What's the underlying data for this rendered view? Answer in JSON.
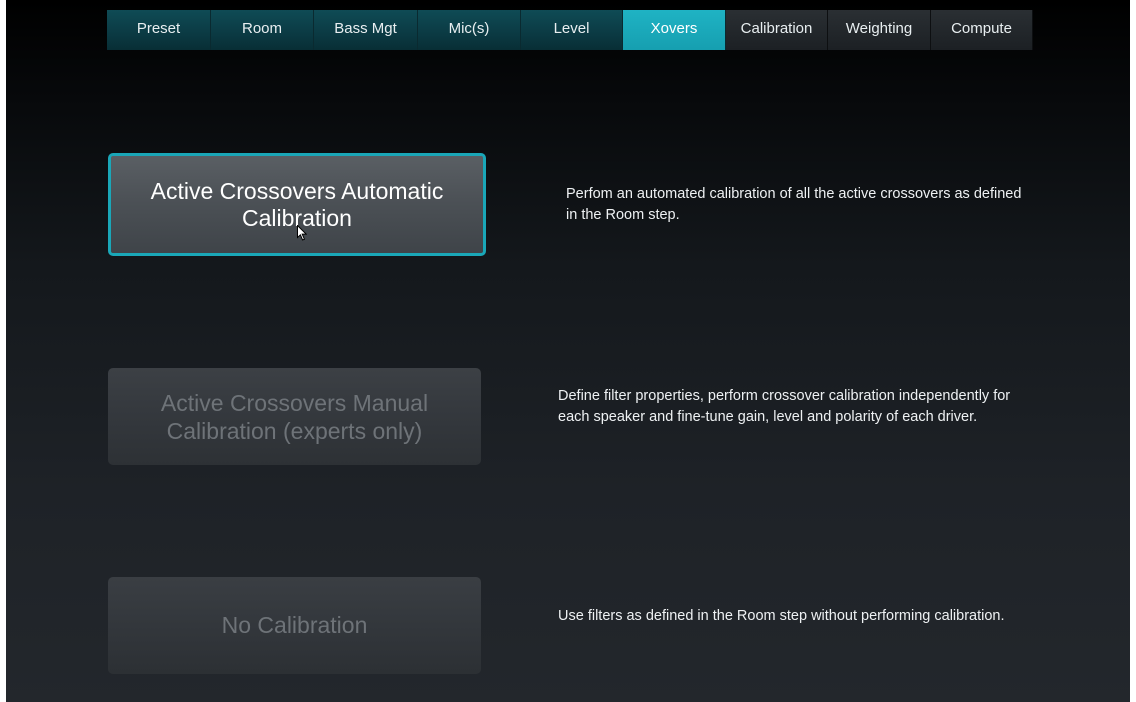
{
  "tabs": [
    {
      "label": "Preset",
      "state": "normal"
    },
    {
      "label": "Room",
      "state": "normal"
    },
    {
      "label": "Bass Mgt",
      "state": "normal"
    },
    {
      "label": "Mic(s)",
      "state": "normal"
    },
    {
      "label": "Level",
      "state": "normal"
    },
    {
      "label": "Xovers",
      "state": "active"
    },
    {
      "label": "Calibration",
      "state": "inactive"
    },
    {
      "label": "Weighting",
      "state": "inactive"
    },
    {
      "label": "Compute",
      "state": "inactive"
    }
  ],
  "options": {
    "auto": {
      "label": "Active Crossovers Automatic Calibration",
      "description": "Perfom an automated calibration of all the active crossovers as defined in the Room step.",
      "selected": true
    },
    "manual": {
      "label": "Active Crossovers Manual Calibration (experts only)",
      "description": "Define filter properties, perform crossover calibration independently for each speaker and fine-tune gain, level and polarity of each driver.",
      "selected": false
    },
    "none": {
      "label": "No Calibration",
      "description": "Use filters as defined in the Room step without performing calibration.",
      "selected": false
    }
  },
  "colors": {
    "accent": "#1aa7b8",
    "tab_teal": "#0b3a43",
    "tab_dark": "#1f2327"
  },
  "cursor_icon": "mouse-pointer-icon"
}
